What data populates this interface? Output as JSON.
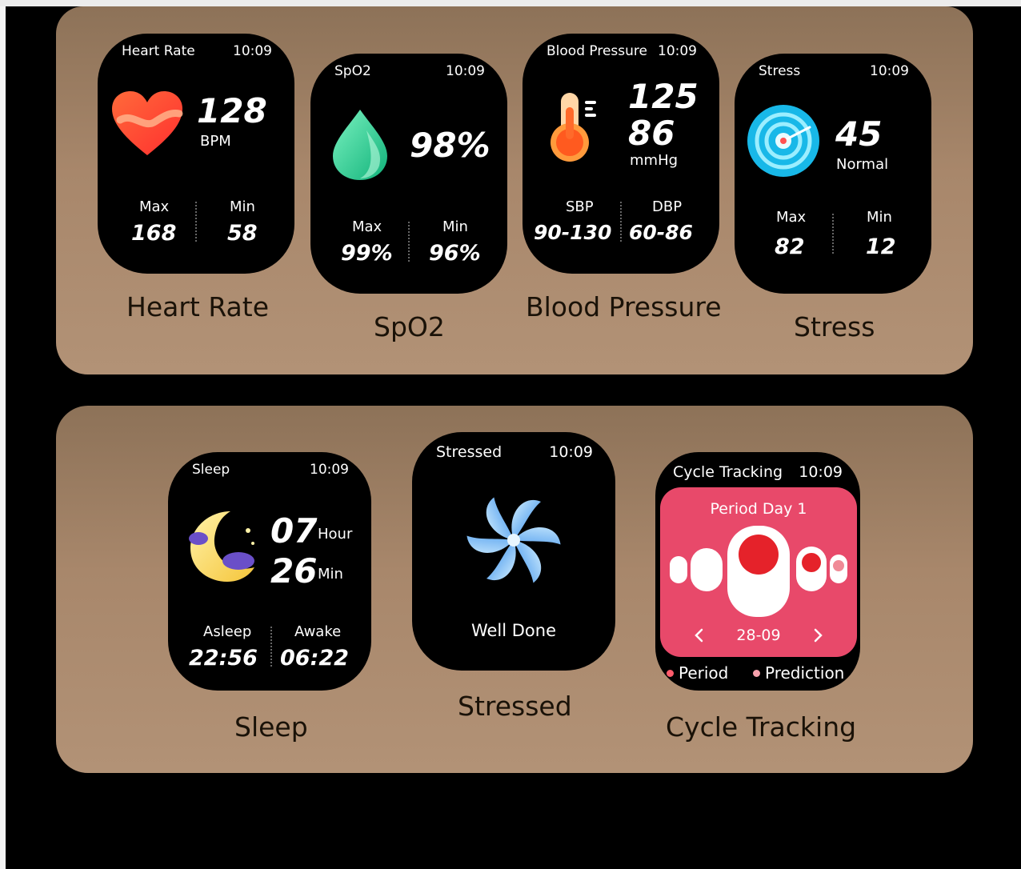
{
  "time": "10:09",
  "colors": {
    "panel": "#a8876b",
    "period_pink": "#e8496a",
    "period_red": "#e5222a",
    "caption": "#1a1208"
  },
  "top_row": [
    {
      "title": "Heart Rate",
      "icon": "heart-icon",
      "value": "128",
      "unit": "BPM",
      "stat1_label": "Max",
      "stat1_value": "168",
      "stat2_label": "Min",
      "stat2_value": "58",
      "caption": "Heart Rate"
    },
    {
      "title": "SpO2",
      "icon": "water-drop-icon",
      "value": "98%",
      "stat1_label": "Max",
      "stat1_value": "99%",
      "stat2_label": "Min",
      "stat2_value": "96%",
      "caption": "SpO2"
    },
    {
      "title": "Blood Pressure",
      "icon": "thermometer-icon",
      "value1": "125",
      "value2": "86",
      "unit": "mmHg",
      "stat1_label": "SBP",
      "stat1_value": "90-130",
      "stat2_label": "DBP",
      "stat2_value": "60-86",
      "caption": "Blood Pressure"
    },
    {
      "title": "Stress",
      "icon": "gauge-icon",
      "value": "45",
      "unit": "Normal",
      "stat1_label": "Max",
      "stat1_value": "82",
      "stat2_label": "Min",
      "stat2_value": "12",
      "caption": "Stress"
    }
  ],
  "bottom_row": [
    {
      "title": "Sleep",
      "icon": "moon-icon",
      "hours": "07",
      "hours_unit": "Hour",
      "minutes": "26",
      "minutes_unit": "Min",
      "stat1_label": "Asleep",
      "stat1_value": "22:56",
      "stat2_label": "Awake",
      "stat2_value": "06:22",
      "caption": "Sleep"
    },
    {
      "title": "Stressed",
      "icon": "pinwheel-icon",
      "message": "Well Done",
      "caption": "Stressed"
    },
    {
      "title": "Cycle Tracking",
      "card_title": "Period Day 1",
      "date": "28-09",
      "legend1": "Period",
      "legend2": "Prediction",
      "caption": "Cycle Tracking"
    }
  ]
}
